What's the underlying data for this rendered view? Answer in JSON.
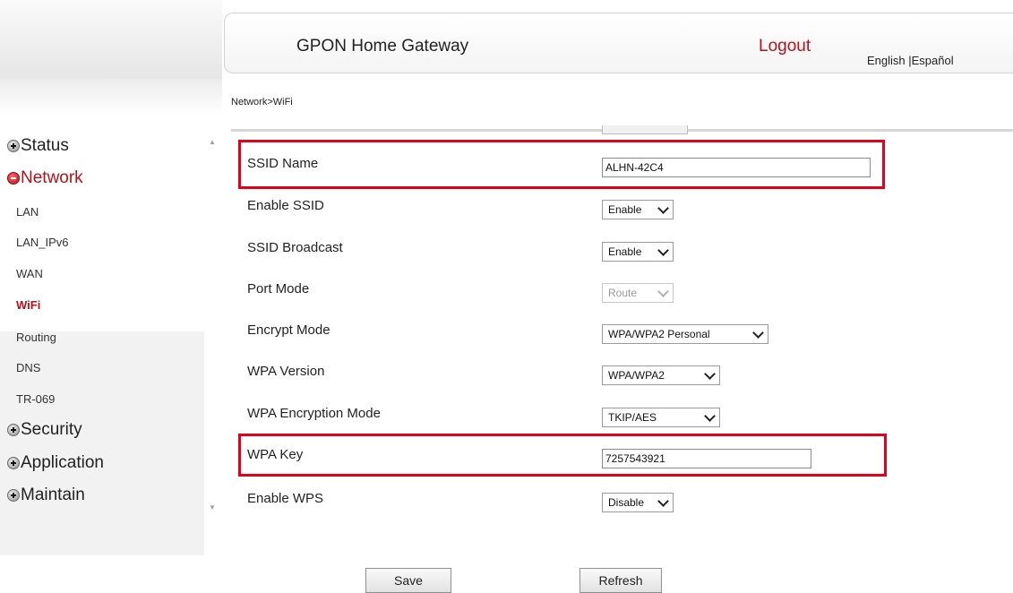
{
  "header": {
    "title": "GPON Home Gateway",
    "logout": "Logout",
    "lang_english": "English",
    "lang_separator": " |",
    "lang_espanol": "Español"
  },
  "breadcrumb": "Network>WiFi",
  "sidebar": {
    "groups": {
      "status": "Status",
      "network": "Network",
      "security": "Security",
      "application": "Application",
      "maintain": "Maintain"
    },
    "network_items": [
      "LAN",
      "LAN_IPv6",
      "WAN",
      "WiFi",
      "Routing",
      "DNS",
      "TR-069"
    ],
    "active_item": "WiFi"
  },
  "form": {
    "ssid_name": {
      "label": "SSID Name",
      "value": "ALHN-42C4"
    },
    "enable_ssid": {
      "label": "Enable SSID",
      "value": "Enable"
    },
    "ssid_broadcast": {
      "label": "SSID Broadcast",
      "value": "Enable"
    },
    "port_mode": {
      "label": "Port Mode",
      "value": "Route"
    },
    "encrypt_mode": {
      "label": "Encrypt Mode",
      "value": "WPA/WPA2 Personal"
    },
    "wpa_version": {
      "label": "WPA Version",
      "value": "WPA/WPA2"
    },
    "wpa_encryption_mode": {
      "label": "WPA Encryption Mode",
      "value": "TKIP/AES"
    },
    "wpa_key": {
      "label": "WPA Key",
      "value": "7257543921"
    },
    "enable_wps": {
      "label": "Enable WPS",
      "value": "Disable"
    }
  },
  "buttons": {
    "save": "Save",
    "refresh": "Refresh"
  },
  "colors": {
    "accent_red": "#b5121b",
    "highlight_red": "#e3001b"
  },
  "icons": {
    "group_expand": "plus-circle-icon",
    "group_collapse": "minus-circle-icon"
  }
}
